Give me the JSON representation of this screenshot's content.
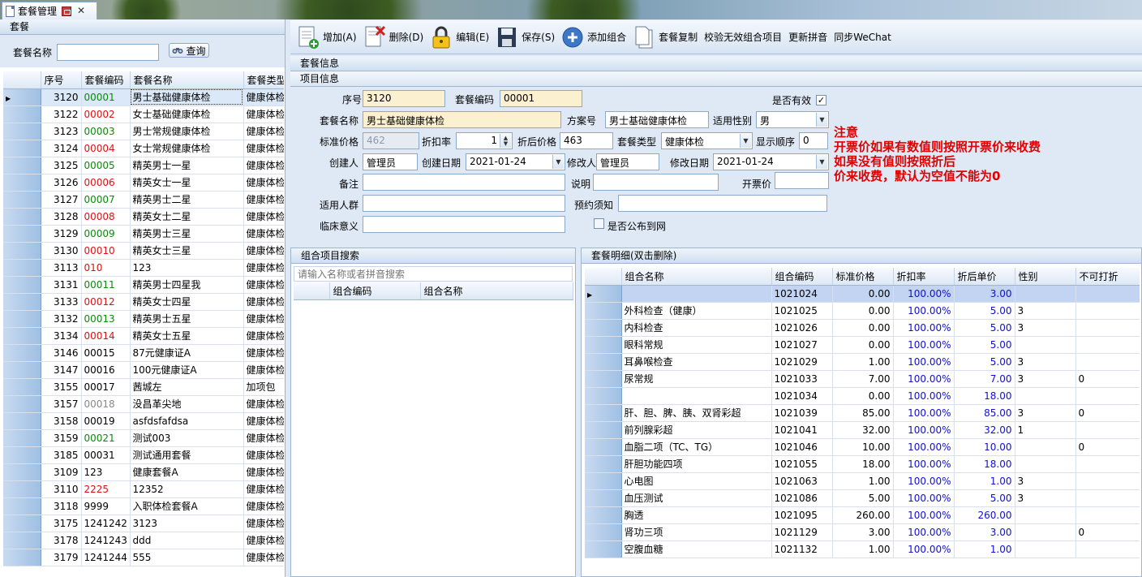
{
  "tab": {
    "title": "套餐管理"
  },
  "left": {
    "header": "套餐",
    "search_label": "套餐名称",
    "search_value": "",
    "query_label": "查询",
    "columns": [
      "序号",
      "套餐编码",
      "套餐名称",
      "套餐类型"
    ],
    "rows": [
      {
        "no": "3120",
        "code": "00001",
        "code_color": "green",
        "name": "男士基础健康体检",
        "type": "健康体检"
      },
      {
        "no": "3122",
        "code": "00002",
        "code_color": "red",
        "name": "女士基础健康体检",
        "type": "健康体检"
      },
      {
        "no": "3123",
        "code": "00003",
        "code_color": "green",
        "name": "男士常规健康体检",
        "type": "健康体检"
      },
      {
        "no": "3124",
        "code": "00004",
        "code_color": "red",
        "name": "女士常规健康体检",
        "type": "健康体检"
      },
      {
        "no": "3125",
        "code": "00005",
        "code_color": "green",
        "name": "精英男士一星",
        "type": "健康体检"
      },
      {
        "no": "3126",
        "code": "00006",
        "code_color": "red",
        "name": "精英女士一星",
        "type": "健康体检"
      },
      {
        "no": "3127",
        "code": "00007",
        "code_color": "green",
        "name": "精英男士二星",
        "type": "健康体检"
      },
      {
        "no": "3128",
        "code": "00008",
        "code_color": "red",
        "name": "精英女士二星",
        "type": "健康体检"
      },
      {
        "no": "3129",
        "code": "00009",
        "code_color": "green",
        "name": "精英男士三星",
        "type": "健康体检"
      },
      {
        "no": "3130",
        "code": "00010",
        "code_color": "red",
        "name": "精英女士三星",
        "type": "健康体检"
      },
      {
        "no": "3113",
        "code": "010",
        "code_color": "red",
        "name": "123",
        "type": "健康体检"
      },
      {
        "no": "3131",
        "code": "00011",
        "code_color": "green",
        "name": "精英男士四星我",
        "type": "健康体检"
      },
      {
        "no": "3133",
        "code": "00012",
        "code_color": "red",
        "name": "精英女士四星",
        "type": "健康体检"
      },
      {
        "no": "3132",
        "code": "00013",
        "code_color": "green",
        "name": "精英男士五星",
        "type": "健康体检"
      },
      {
        "no": "3134",
        "code": "00014",
        "code_color": "red",
        "name": "精英女士五星",
        "type": "健康体检"
      },
      {
        "no": "3146",
        "code": "00015",
        "code_color": "black",
        "name": "87元健康证A",
        "type": "健康体检"
      },
      {
        "no": "3147",
        "code": "00016",
        "code_color": "black",
        "name": "100元健康证A",
        "type": "健康体检"
      },
      {
        "no": "3155",
        "code": "00017",
        "code_color": "black",
        "name": "茜城左",
        "type": "加项包"
      },
      {
        "no": "3157",
        "code": "00018",
        "code_color": "gray",
        "name": "没昌革尖地",
        "type": "健康体检"
      },
      {
        "no": "3158",
        "code": "00019",
        "code_color": "black",
        "name": "asfdsfafdsa",
        "type": "健康体检"
      },
      {
        "no": "3159",
        "code": "00021",
        "code_color": "green",
        "name": "测试003",
        "type": "健康体检"
      },
      {
        "no": "3185",
        "code": "00031",
        "code_color": "black",
        "name": "测试通用套餐",
        "type": "健康体检"
      },
      {
        "no": "3109",
        "code": "123",
        "code_color": "black",
        "name": "健康套餐A",
        "type": "健康体检"
      },
      {
        "no": "3110",
        "code": "2225",
        "code_color": "red",
        "name": "12352",
        "type": "健康体检"
      },
      {
        "no": "3118",
        "code": "9999",
        "code_color": "black",
        "name": "入职体检套餐A",
        "type": "健康体检"
      },
      {
        "no": "3175",
        "code": "1241242",
        "code_color": "black",
        "name": "3123",
        "type": "健康体检"
      },
      {
        "no": "3178",
        "code": "1241243",
        "code_color": "black",
        "name": "ddd",
        "type": "健康体检"
      },
      {
        "no": "3179",
        "code": "1241244",
        "code_color": "black",
        "name": "555",
        "type": "健康体检"
      }
    ]
  },
  "toolbar": {
    "add": "增加(A)",
    "delete": "删除(D)",
    "edit": "编辑(E)",
    "save": "保存(S)",
    "add_combo": "添加组合",
    "copy": "套餐复制",
    "validate": "校验无效组合项目",
    "update_pinyin": "更新拼音",
    "sync_wechat": "同步WeChat"
  },
  "info": {
    "header": "套餐信息",
    "subheader": "项目信息",
    "labels": {
      "seq": "序号",
      "code": "套餐编码",
      "valid": "是否有效",
      "name": "套餐名称",
      "plan_no": "方案号",
      "gender": "适用性别",
      "std_price": "标准价格",
      "discount": "折扣率",
      "after_price": "折后价格",
      "type": "套餐类型",
      "order": "显示顺序",
      "creator": "创建人",
      "create_date": "创建日期",
      "modifier": "修改人",
      "modify_date": "修改日期",
      "remark": "备注",
      "explain": "说明",
      "invoice_price": "开票价",
      "audience": "适用人群",
      "notice": "预约须知",
      "clinical": "临床意义",
      "publish": "是否公布到网"
    },
    "values": {
      "seq": "3120",
      "code": "00001",
      "name": "男士基础健康体检",
      "plan_no": "男士基础健康体检",
      "gender": "男",
      "std_price": "462",
      "discount": "1",
      "after_price": "463",
      "type": "健康体检",
      "order": "0",
      "creator": "管理员",
      "create_date": "2021-01-24",
      "modifier": "管理员",
      "modify_date": "2021-01-24",
      "remark": "",
      "explain": "",
      "invoice_price": "",
      "audience": "",
      "notice": "",
      "clinical": ""
    },
    "note_lines": [
      "注意",
      "开票价如果有数值则按照开票价来收费",
      "如果没有值则按照折后",
      "价来收费，默认为空值不能为0"
    ]
  },
  "combo_search": {
    "header": "组合项目搜索",
    "placeholder": "请输入名称或者拼音搜索",
    "columns": [
      "组合编码",
      "组合名称"
    ]
  },
  "detail": {
    "header": "套餐明细(双击删除)",
    "columns": [
      "组合名称",
      "组合编码",
      "标准价格",
      "折扣率",
      "折后单价",
      "性别",
      "不可打折"
    ],
    "rows": [
      {
        "name": "",
        "code": "1021024",
        "price": "0.00",
        "rate": "100.00%",
        "unit": "3.00",
        "sex": "",
        "nodisc": ""
      },
      {
        "name": "外科检查（健康）",
        "code": "1021025",
        "price": "0.00",
        "rate": "100.00%",
        "unit": "5.00",
        "sex": "3",
        "nodisc": ""
      },
      {
        "name": "内科检查",
        "code": "1021026",
        "price": "0.00",
        "rate": "100.00%",
        "unit": "5.00",
        "sex": "3",
        "nodisc": ""
      },
      {
        "name": "眼科常规",
        "code": "1021027",
        "price": "0.00",
        "rate": "100.00%",
        "unit": "5.00",
        "sex": "",
        "nodisc": ""
      },
      {
        "name": "耳鼻喉检查",
        "code": "1021029",
        "price": "1.00",
        "rate": "100.00%",
        "unit": "5.00",
        "sex": "3",
        "nodisc": ""
      },
      {
        "name": "尿常规",
        "code": "1021033",
        "price": "7.00",
        "rate": "100.00%",
        "unit": "7.00",
        "sex": "3",
        "nodisc": "0"
      },
      {
        "name": "",
        "code": "1021034",
        "price": "0.00",
        "rate": "100.00%",
        "unit": "18.00",
        "sex": "",
        "nodisc": ""
      },
      {
        "name": "肝、胆、脾、胰、双肾彩超",
        "code": "1021039",
        "price": "85.00",
        "rate": "100.00%",
        "unit": "85.00",
        "sex": "3",
        "nodisc": "0"
      },
      {
        "name": "前列腺彩超",
        "code": "1021041",
        "price": "32.00",
        "rate": "100.00%",
        "unit": "32.00",
        "sex": "1",
        "nodisc": ""
      },
      {
        "name": "血脂二项（TC、TG）",
        "code": "1021046",
        "price": "10.00",
        "rate": "100.00%",
        "unit": "10.00",
        "sex": "",
        "nodisc": "0"
      },
      {
        "name": "肝胆功能四项",
        "code": "1021055",
        "price": "18.00",
        "rate": "100.00%",
        "unit": "18.00",
        "sex": "",
        "nodisc": ""
      },
      {
        "name": "心电图",
        "code": "1021063",
        "price": "1.00",
        "rate": "100.00%",
        "unit": "1.00",
        "sex": "3",
        "nodisc": ""
      },
      {
        "name": "血压测试",
        "code": "1021086",
        "price": "5.00",
        "rate": "100.00%",
        "unit": "5.00",
        "sex": "3",
        "nodisc": ""
      },
      {
        "name": "胸透",
        "code": "1021095",
        "price": "260.00",
        "rate": "100.00%",
        "unit": "260.00",
        "sex": "",
        "nodisc": ""
      },
      {
        "name": "肾功三项",
        "code": "1021129",
        "price": "3.00",
        "rate": "100.00%",
        "unit": "3.00",
        "sex": "",
        "nodisc": "0"
      },
      {
        "name": "空腹血糖",
        "code": "1021132",
        "price": "1.00",
        "rate": "100.00%",
        "unit": "1.00",
        "sex": "",
        "nodisc": ""
      }
    ]
  },
  "colors": {
    "code_red": "#e01010",
    "code_green": "#0a8a0a",
    "note_red": "#e00000",
    "rate_blue": "#1010d0"
  }
}
